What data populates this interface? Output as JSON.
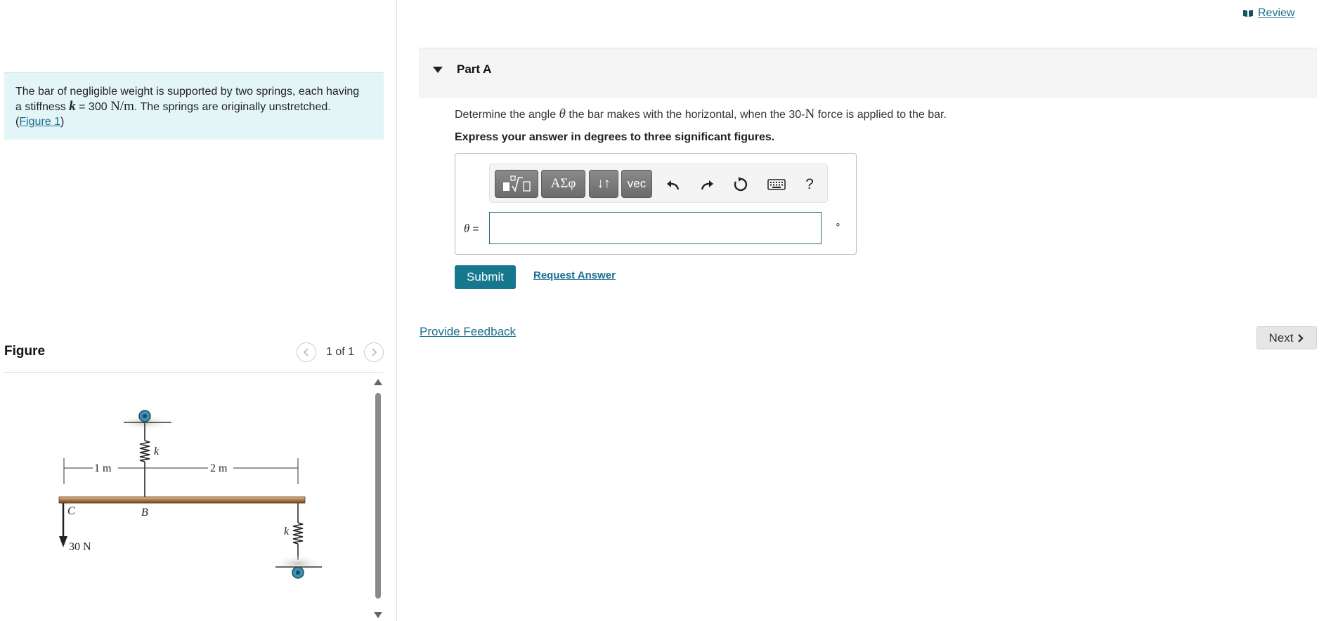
{
  "review": {
    "label": "Review",
    "icon": "book-icon"
  },
  "problem": {
    "line1": "The bar of negligible weight is supported by two springs, each having",
    "line2_a": "a stiffness ",
    "k": "k",
    "eq": " = 300 ",
    "unit": "N/m",
    "line2_b": ". The springs are originally unstretched.",
    "paren_open": "(",
    "figure_link": "Figure 1",
    "paren_close": ")"
  },
  "figure": {
    "title": "Figure",
    "pager": "1 of 1",
    "prev_icon": "chevron-left-icon",
    "next_icon": "chevron-right-icon",
    "labels": {
      "dim1": "1 m",
      "dim2": "2 m",
      "k_top": "k",
      "k_bottom": "k",
      "point_c": "C",
      "point_b": "B",
      "force": "30 N"
    }
  },
  "part": {
    "title": "Part A"
  },
  "question": {
    "pre": "Determine the angle ",
    "theta": "θ",
    "mid": " the bar makes with the horizontal, when the 30-",
    "unit": "N",
    "post": " force is applied to the bar."
  },
  "instruction": "Express your answer in degrees to three significant figures.",
  "toolbar": {
    "template_icon": "template-sqrt-icon",
    "greek_label": "ΑΣφ",
    "arrows_label": "↓↑",
    "vec_label": "vec",
    "undo_icon": "undo-icon",
    "redo_icon": "redo-icon",
    "reset_icon": "reset-icon",
    "keyboard_icon": "keyboard-icon",
    "help_label": "?"
  },
  "answer": {
    "label_var": "θ",
    "label_eq": " =",
    "value": "",
    "unit": "∘"
  },
  "actions": {
    "submit": "Submit",
    "request": "Request Answer",
    "feedback": "Provide Feedback",
    "next": "Next"
  }
}
